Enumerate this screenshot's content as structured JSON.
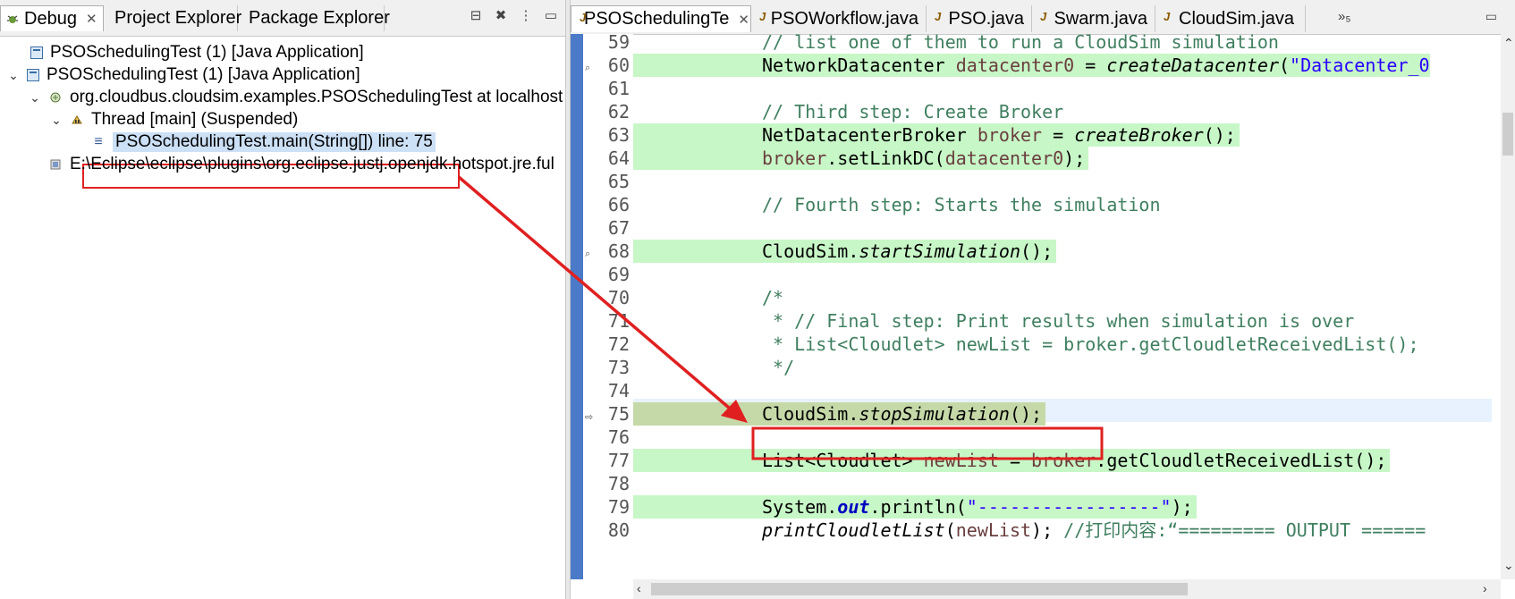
{
  "left_tabs": [
    {
      "label": "Debug",
      "icon": "debug-icon",
      "active": true
    },
    {
      "label": "Project Explorer",
      "icon": "project-explorer-icon",
      "active": false
    },
    {
      "label": "Package Explorer",
      "icon": "package-explorer-icon",
      "active": false
    }
  ],
  "view_buttons": [
    "collapse-all-icon",
    "remove-terminated-icon",
    "view-menu-icon",
    "minimize-icon"
  ],
  "debug_tree": [
    {
      "label": "PSOSchedulingTest (1) [Java Application]",
      "icon": "java-application-icon",
      "twistie": ""
    },
    {
      "label": "PSOSchedulingTest (1) [Java Application]",
      "icon": "java-application-icon",
      "twistie": "v"
    },
    {
      "label": "org.cloudbus.cloudsim.examples.PSOSchedulingTest at localhost",
      "icon": "debug-target-icon",
      "twistie": "v"
    },
    {
      "label": "Thread [main] (Suspended)",
      "icon": "thread-suspended-icon",
      "twistie": "v"
    },
    {
      "label": "PSOSchedulingTest.main(String[]) line: 75",
      "icon": "stack-frame-icon",
      "twistie": ""
    },
    {
      "label": "E:\\Eclipse\\eclipse\\plugins\\org.eclipse.justj.openjdk.hotspot.jre.ful",
      "icon": "process-icon",
      "twistie": ""
    }
  ],
  "editor_tabs": [
    {
      "label": "PSOSchedulingTe",
      "active": true,
      "closable": true
    },
    {
      "label": "PSOWorkflow.java",
      "active": false,
      "closable": false
    },
    {
      "label": "PSO.java",
      "active": false,
      "closable": false
    },
    {
      "label": "Swarm.java",
      "active": false,
      "closable": false
    },
    {
      "label": "CloudSim.java",
      "active": false,
      "closable": false
    }
  ],
  "more_tabs": "»₅",
  "line_numbers": [
    "59",
    "60",
    "61",
    "62",
    "63",
    "64",
    "65",
    "66",
    "67",
    "68",
    "69",
    "70",
    "71",
    "72",
    "73",
    "74",
    "75",
    "76",
    "77",
    "78",
    "79",
    "80"
  ],
  "code_text": {
    "l59": "// list one of them to run a CloudSim simulation",
    "l60_a": "NetworkDatacenter ",
    "l60_var": "datacenter0",
    "l60_b": " = ",
    "l60_call": "createDatacenter",
    "l60_c": "(",
    "l60_str": "\"Datacenter_0",
    "l62": "// Third step: Create Broker",
    "l63_a": "NetDatacenterBroker ",
    "l63_var": "broker",
    "l63_b": " = ",
    "l63_call": "createBroker",
    "l63_c": "();",
    "l64_var": "broker",
    "l64_a": ".setLinkDC(",
    "l64_var2": "datacenter0",
    "l64_b": ");",
    "l66": "// Fourth step: Starts the simulation",
    "l68_a": "CloudSim.",
    "l68_call": "startSimulation",
    "l68_b": "();",
    "l70": "/*",
    "l71": " * // Final step: Print results when simulation is over",
    "l72": " * List<Cloudlet> newList = broker.getCloudletReceivedList();",
    "l73": " */",
    "l75_a": "CloudSim.",
    "l75_call": "stopSimulation",
    "l75_b": "();",
    "l77_a": "List<Cloudlet> ",
    "l77_var": "newList",
    "l77_b": " = ",
    "l77_var2": "broker",
    "l77_c": ".getCloudletReceivedList();",
    "l79_a": "System.",
    "l79_fld": "out",
    "l79_b": ".println(",
    "l79_str": "\"-----------------\"",
    "l79_c": ");",
    "l80_call": "printCloudletList",
    "l80_a": "(",
    "l80_var": "newList",
    "l80_b": "); ",
    "l80_cm": "//打印内容:“========= OUTPUT ======"
  },
  "colors": {
    "annotation_red": "#e02020",
    "highlight_green": "#c7f7c7",
    "execution_line": "#c5d9a8",
    "ruler_blue": "#4a7ac8"
  }
}
